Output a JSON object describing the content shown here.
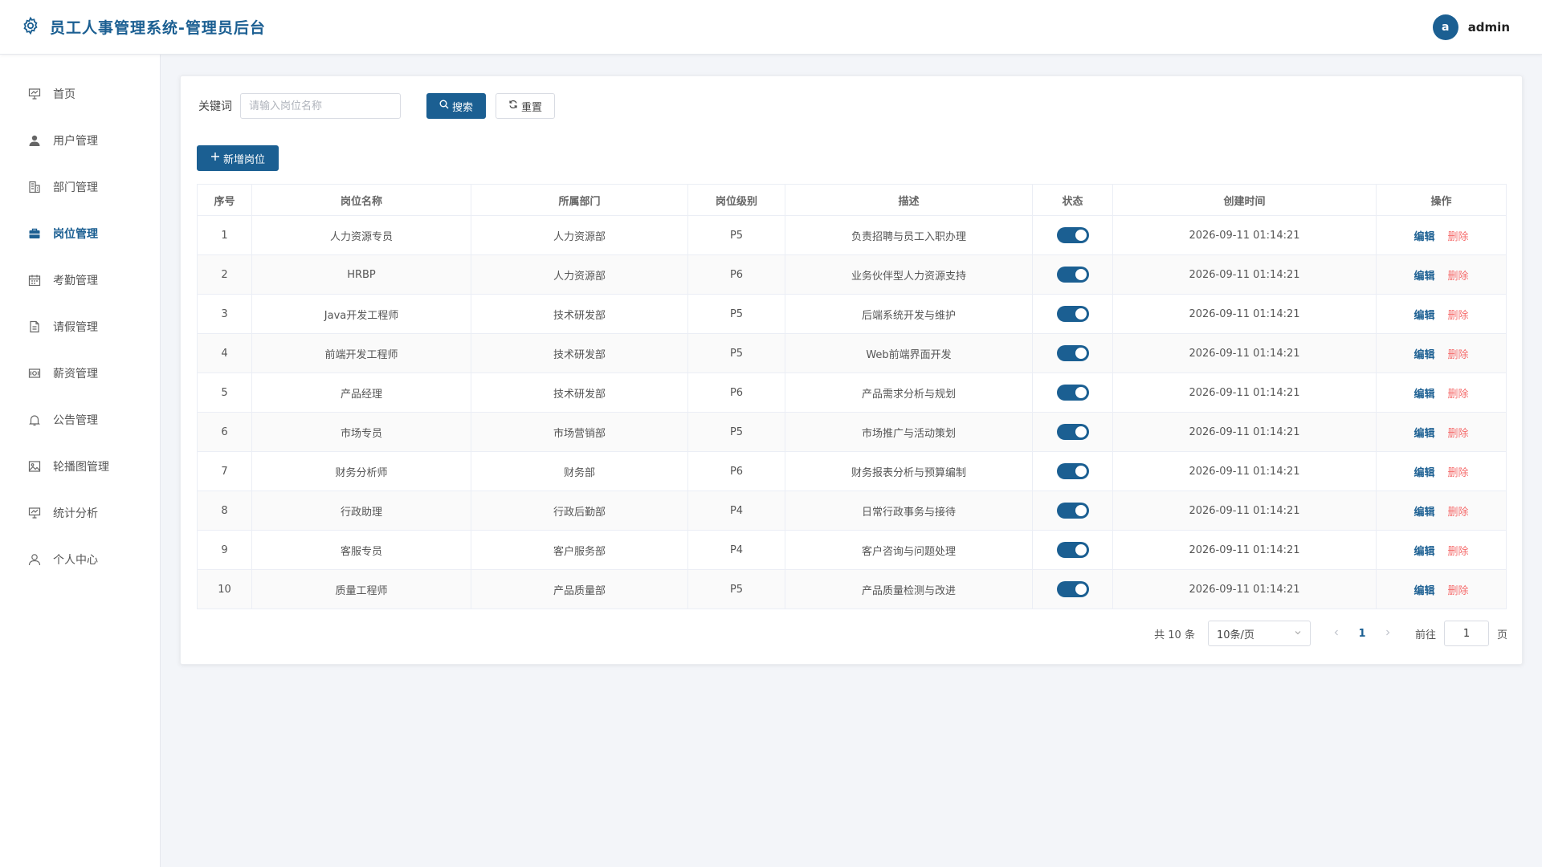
{
  "header": {
    "title": "员工人事管理系统-管理员后台",
    "avatar_letter": "a",
    "username": "admin"
  },
  "colors": {
    "primary": "#1b5f92",
    "danger": "#f56c6c"
  },
  "sidebar": {
    "items": [
      {
        "label": "首页",
        "icon": "presentation-board-icon"
      },
      {
        "label": "用户管理",
        "icon": "user-icon"
      },
      {
        "label": "部门管理",
        "icon": "building-icon"
      },
      {
        "label": "岗位管理",
        "icon": "briefcase-icon",
        "active": true
      },
      {
        "label": "考勤管理",
        "icon": "calendar-icon"
      },
      {
        "label": "请假管理",
        "icon": "document-icon"
      },
      {
        "label": "薪资管理",
        "icon": "money-icon"
      },
      {
        "label": "公告管理",
        "icon": "bell-icon"
      },
      {
        "label": "轮播图管理",
        "icon": "image-icon"
      },
      {
        "label": "统计分析",
        "icon": "chart-board-icon"
      },
      {
        "label": "个人中心",
        "icon": "user-outline-icon"
      }
    ]
  },
  "search": {
    "label": "关键词",
    "placeholder": "请输入岗位名称",
    "search_label": "搜索",
    "reset_label": "重置"
  },
  "add_label": "新增岗位",
  "table": {
    "headers": [
      "序号",
      "岗位名称",
      "所属部门",
      "岗位级别",
      "描述",
      "状态",
      "创建时间",
      "操作"
    ],
    "edit_label": "编辑",
    "delete_label": "删除",
    "rows": [
      {
        "no": "1",
        "name": "人力资源专员",
        "dept": "人力资源部",
        "level": "P5",
        "desc": "负责招聘与员工入职办理",
        "status": true,
        "created": "2026-09-11 01:14:21"
      },
      {
        "no": "2",
        "name": "HRBP",
        "dept": "人力资源部",
        "level": "P6",
        "desc": "业务伙伴型人力资源支持",
        "status": true,
        "created": "2026-09-11 01:14:21"
      },
      {
        "no": "3",
        "name": "Java开发工程师",
        "dept": "技术研发部",
        "level": "P5",
        "desc": "后端系统开发与维护",
        "status": true,
        "created": "2026-09-11 01:14:21"
      },
      {
        "no": "4",
        "name": "前端开发工程师",
        "dept": "技术研发部",
        "level": "P5",
        "desc": "Web前端界面开发",
        "status": true,
        "created": "2026-09-11 01:14:21"
      },
      {
        "no": "5",
        "name": "产品经理",
        "dept": "技术研发部",
        "level": "P6",
        "desc": "产品需求分析与规划",
        "status": true,
        "created": "2026-09-11 01:14:21"
      },
      {
        "no": "6",
        "name": "市场专员",
        "dept": "市场营销部",
        "level": "P5",
        "desc": "市场推广与活动策划",
        "status": true,
        "created": "2026-09-11 01:14:21"
      },
      {
        "no": "7",
        "name": "财务分析师",
        "dept": "财务部",
        "level": "P6",
        "desc": "财务报表分析与预算编制",
        "status": true,
        "created": "2026-09-11 01:14:21"
      },
      {
        "no": "8",
        "name": "行政助理",
        "dept": "行政后勤部",
        "level": "P4",
        "desc": "日常行政事务与接待",
        "status": true,
        "created": "2026-09-11 01:14:21"
      },
      {
        "no": "9",
        "name": "客服专员",
        "dept": "客户服务部",
        "level": "P4",
        "desc": "客户咨询与问题处理",
        "status": true,
        "created": "2026-09-11 01:14:21"
      },
      {
        "no": "10",
        "name": "质量工程师",
        "dept": "产品质量部",
        "level": "P5",
        "desc": "产品质量检测与改进",
        "status": true,
        "created": "2026-09-11 01:14:21"
      }
    ]
  },
  "pagination": {
    "total_text": "共 10 条",
    "page_size": "10条/页",
    "current_page": "1",
    "goto_label": "前往",
    "goto_value": "1",
    "page_unit": "页"
  }
}
